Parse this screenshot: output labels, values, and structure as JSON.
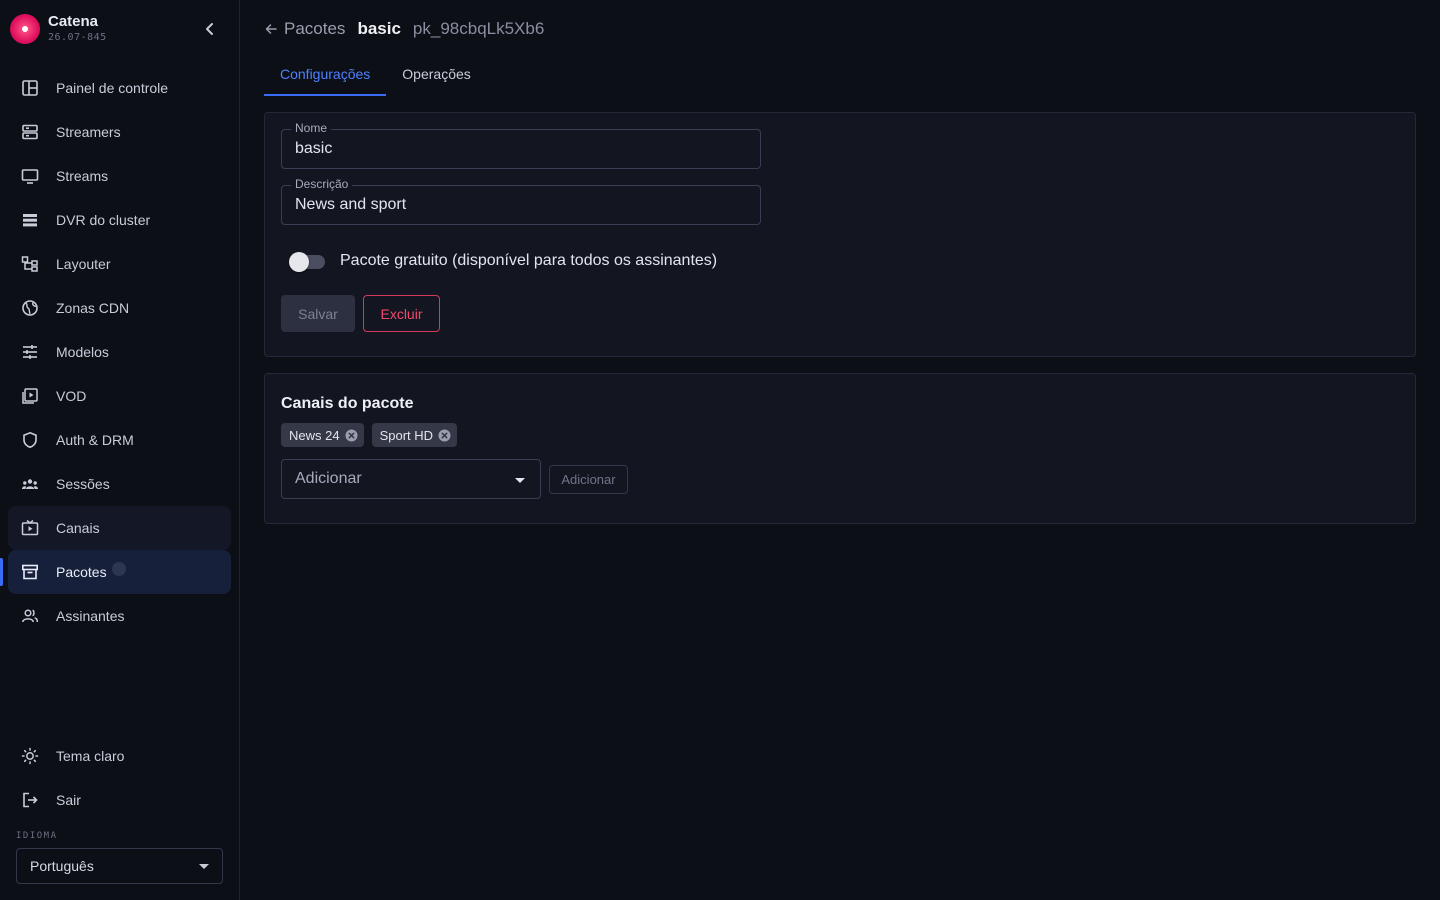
{
  "brand": {
    "name": "Catena",
    "version": "26.07-845"
  },
  "sidebar": {
    "items": [
      {
        "label": "Painel de controle",
        "icon": "dashboard-icon"
      },
      {
        "label": "Streamers",
        "icon": "servers-icon"
      },
      {
        "label": "Streams",
        "icon": "monitor-icon"
      },
      {
        "label": "DVR do cluster",
        "icon": "storage-icon"
      },
      {
        "label": "Layouter",
        "icon": "layout-tree-icon"
      },
      {
        "label": "Zonas CDN",
        "icon": "globe-icon"
      },
      {
        "label": "Modelos",
        "icon": "sliders-icon"
      },
      {
        "label": "VOD",
        "icon": "video-library-icon"
      },
      {
        "label": "Auth & DRM",
        "icon": "shield-icon"
      },
      {
        "label": "Sessões",
        "icon": "group-icon"
      },
      {
        "label": "Canais",
        "icon": "tv-play-icon"
      },
      {
        "label": "Pacotes",
        "icon": "archive-box-icon"
      },
      {
        "label": "Assinantes",
        "icon": "users-icon"
      }
    ],
    "active": "Pacotes",
    "bottom": [
      {
        "label": "Tema claro",
        "icon": "sun-icon"
      },
      {
        "label": "Sair",
        "icon": "logout-icon"
      }
    ],
    "language_label": "IDIOMA",
    "language_value": "Português"
  },
  "breadcrumb": {
    "parent": "Pacotes",
    "current": "basic",
    "id": "pk_98cbqLk5Xb6"
  },
  "tabs": [
    {
      "label": "Configurações"
    },
    {
      "label": "Operações"
    }
  ],
  "form": {
    "name_label": "Nome",
    "name_value": "basic",
    "description_label": "Descrição",
    "description_value": "News and sport",
    "free_toggle_label": "Pacote gratuito (disponível para todos os assinantes)",
    "free_toggle_on": false,
    "save_label": "Salvar",
    "delete_label": "Excluir"
  },
  "channels": {
    "title": "Canais do pacote",
    "items": [
      "News 24",
      "Sport HD"
    ],
    "add_placeholder": "Adicionar",
    "add_button": "Adicionar"
  },
  "colors": {
    "accent": "#3b6cf6",
    "danger": "#ef4a6d",
    "brand": "#e0115f"
  }
}
